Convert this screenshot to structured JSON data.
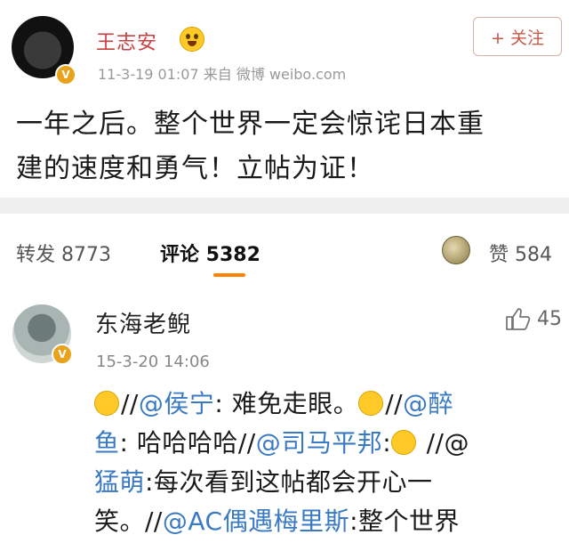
{
  "post": {
    "author": "王志安",
    "follow_label": "+ 关注",
    "meta": "11-3-19 01:07  来自 微博 weibo.com",
    "text_line1": "一年之后。整个世界一定会惊诧日本重",
    "text_line2": "建的速度和勇气！立帖为证！"
  },
  "tabs": {
    "repost": "转发 8773",
    "comment": "评论 5382",
    "likes": "赞 584"
  },
  "comment": {
    "author": "东海老鲵",
    "time": "15-3-20 14:06",
    "like_count": "45",
    "line1_a": "//",
    "line1_b": "@侯宁",
    "line1_c": ": 难免走眼。",
    "line1_d": "//",
    "line1_e": "@醉",
    "line2_a": "鱼",
    "line2_b": ": 哈哈哈哈//",
    "line2_c": "@司马平邦",
    "line2_d": ":",
    "line2_e": " //@",
    "line3_a": "猛萌",
    "line3_b": ":每次看到这帖都会开心一",
    "line4_a": "笑。//",
    "line4_b": "@AC偶遇梅里斯",
    "line4_c": ":整个世界"
  },
  "colors": {
    "author_red": "#c9403e",
    "accent_orange": "#ff8200",
    "mention_blue": "#3a7ac2",
    "verified_gold": "#e8a21c"
  },
  "icons": [
    "verified-badge-icon",
    "emoji-icon",
    "like-icon"
  ]
}
